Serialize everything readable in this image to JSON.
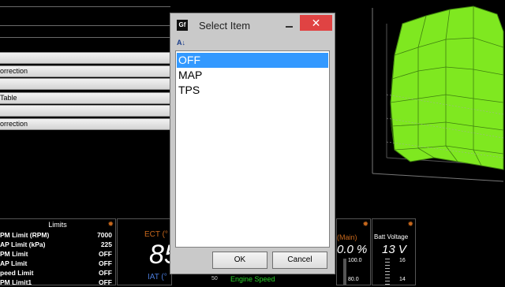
{
  "left_panel": {
    "rows": [
      "orrection",
      "Table",
      "orrection"
    ]
  },
  "limits_gauge": {
    "title": "Limits",
    "rows": [
      {
        "label": "PM Limit (RPM)",
        "value": "7000"
      },
      {
        "label": "AP Limit (kPa)",
        "value": "225"
      },
      {
        "label": "PM Limit",
        "value": "OFF"
      },
      {
        "label": "AP Limit",
        "value": "OFF"
      },
      {
        "label": "peed Limit",
        "value": "OFF"
      },
      {
        "label": "PM Limit1",
        "value": "OFF"
      }
    ]
  },
  "ect_gauge": {
    "label": "ECT (°",
    "value": "85",
    "sub_label": "IAT (°"
  },
  "dialog": {
    "title": "Select Item",
    "app_icon": "Gf",
    "close_glyph": "✕",
    "sort_glyph": "A↓",
    "items": [
      "OFF",
      "MAP",
      "TPS"
    ],
    "selected_index": 0,
    "ok_label": "OK",
    "cancel_label": "Cancel"
  },
  "engine_speed_label": "Engine Speed",
  "map_gauge": {
    "label": "(Main)",
    "value": "0.0 %",
    "ticks": [
      "100.0",
      "80.0"
    ]
  },
  "batt_gauge": {
    "label": "Batt Voltage",
    "value": "13 V",
    "ticks": [
      "16",
      "14"
    ]
  },
  "ect_ticks": [
    "50"
  ],
  "colors": {
    "selection": "#3399ff",
    "close": "#e04343",
    "surface_3d": "#7fe820",
    "gauge_title": "#c8681c"
  }
}
